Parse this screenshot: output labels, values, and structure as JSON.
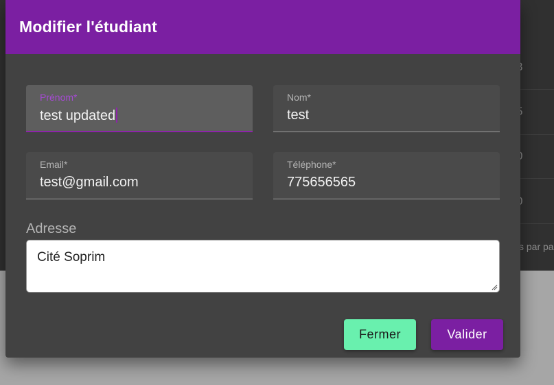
{
  "background": {
    "table_cells": [
      "3",
      "5",
      "0",
      "0"
    ],
    "pager_text": "s par pa"
  },
  "modal": {
    "title": "Modifier l'étudiant",
    "fields": {
      "prenom": {
        "label": "Prénom*",
        "value": "test updated"
      },
      "nom": {
        "label": "Nom*",
        "value": "test"
      },
      "email": {
        "label": "Email*",
        "value": "test@gmail.com"
      },
      "telephone": {
        "label": "Téléphone*",
        "value": "775656565"
      }
    },
    "adresse": {
      "label": "Adresse",
      "value": "Cité Soprim"
    },
    "buttons": {
      "close_label": "Fermer",
      "submit_label": "Valider"
    }
  },
  "colors": {
    "primary": "#7b1fa2",
    "accent": "#69f0ae",
    "surface": "#424242"
  }
}
